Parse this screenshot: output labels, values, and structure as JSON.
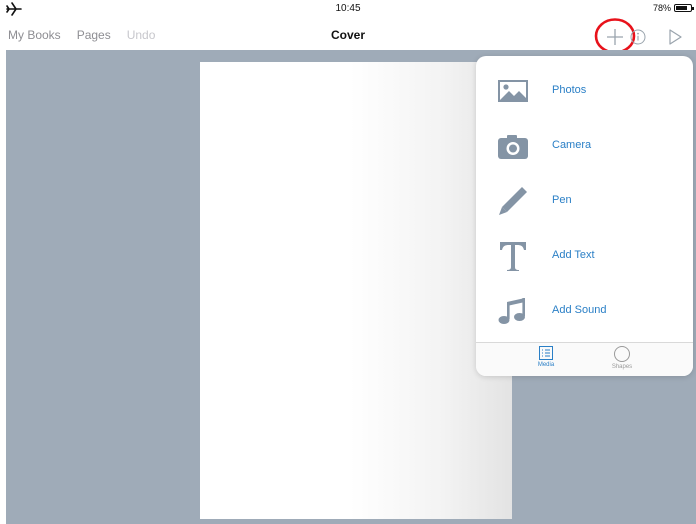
{
  "status_bar": {
    "time": "10:45",
    "battery_percent": "78%",
    "battery_level": 0.78,
    "airplane_mode": true
  },
  "nav_bar": {
    "left_items": [
      "My Books",
      "Pages",
      "Undo"
    ],
    "title": "Cover",
    "right_icons": [
      "plus-icon",
      "info-icon",
      "play-icon"
    ],
    "highlight_color": "#e8121b"
  },
  "popover": {
    "items": [
      {
        "label": "Photos",
        "icon": "photos-icon"
      },
      {
        "label": "Camera",
        "icon": "camera-icon"
      },
      {
        "label": "Pen",
        "icon": "pen-icon"
      },
      {
        "label": "Add Text",
        "icon": "text-icon"
      },
      {
        "label": "Add Sound",
        "icon": "music-note-icon"
      }
    ],
    "tabs": [
      {
        "label": "Media",
        "icon": "list-icon",
        "active": true
      },
      {
        "label": "Shapes",
        "icon": "circle-icon",
        "active": false
      }
    ],
    "accent_color": "#2a7fc6",
    "icon_color": "#8494a5"
  },
  "canvas": {
    "background_color": "#9fabb8"
  }
}
